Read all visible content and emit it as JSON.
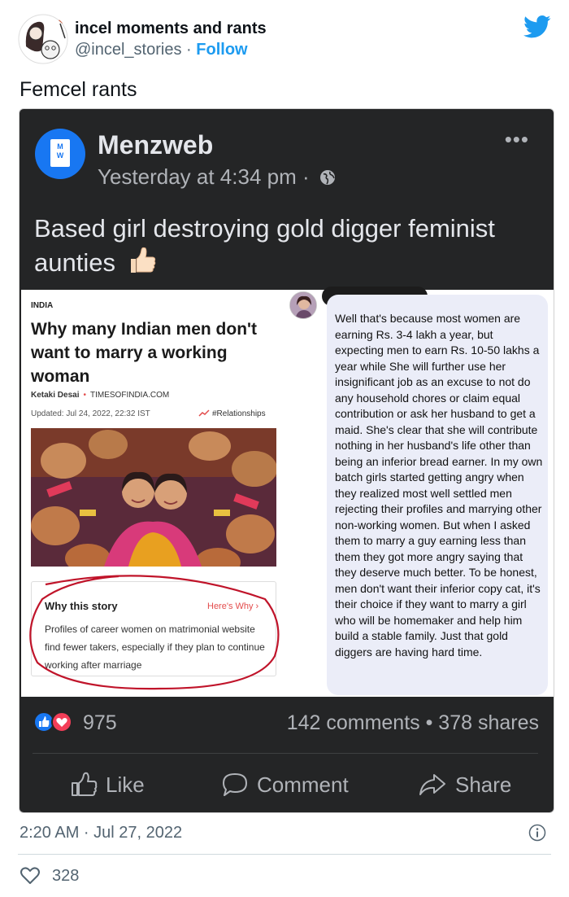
{
  "tweet": {
    "author_name": "incel moments and rants",
    "handle": "@incel_stories",
    "separator": "·",
    "follow_label": "Follow",
    "text": "Femcel rants",
    "date": "2:20 AM · Jul 27, 2022",
    "like_count": "328"
  },
  "embed": {
    "page_name": "Menzweb",
    "avatar_letters": [
      "M",
      "W"
    ],
    "timestamp": "Yesterday at 4:34 pm ·",
    "more_label": "•••",
    "body": "Based girl destroying gold digger feminist aunties",
    "article": {
      "section": "INDIA",
      "title": "Why many Indian men don't want to marry a working woman",
      "author": "Ketaki Desai",
      "publisher": "TIMESOFINDIA.COM",
      "updated": "Updated: Jul 24, 2022, 22:32 IST",
      "tag": "#Relationships",
      "why_title": "Why this story",
      "why_link": "Here's Why",
      "why_body": "Profiles of career women on matrimonial website find fewer takers, especially if they plan to continue working after marriage"
    },
    "comment_text": "Well that's because most women are earning Rs. 3-4 lakh a year, but expecting men to earn Rs. 10-50 lakhs a year while She will further use her insignificant job as an excuse to not do any household chores or claim equal contribution or ask her husband to get a maid. She's clear that she will contribute nothing in her husband's life other than being an inferior bread earner. In my own batch girls started getting angry when they realized most well settled men rejecting their profiles and marrying other non-working women. But when I asked them to marry a guy earning less than them they got more angry saying that they deserve much better. To be honest, men don't want their inferior copy cat, it's their choice if they want to marry a girl who will be homemaker and help him build a stable family. Just that gold diggers are having hard time.",
    "reaction_count": "975",
    "stats": "142 comments • 378 shares",
    "actions": {
      "like": "Like",
      "comment": "Comment",
      "share": "Share"
    }
  },
  "colors": {
    "twitter_blue": "#1d9bf0",
    "facebook_blue": "#1877f2",
    "facebook_dark": "#242526",
    "love_red": "#f33e58",
    "toi_red": "#e34c4c"
  },
  "icons": [
    "twitter-bird-icon",
    "globe-icon",
    "thumbs-up-emoji-icon",
    "like-reaction-icon",
    "love-reaction-icon",
    "like-icon",
    "comment-icon",
    "share-icon",
    "info-icon",
    "heart-icon"
  ]
}
